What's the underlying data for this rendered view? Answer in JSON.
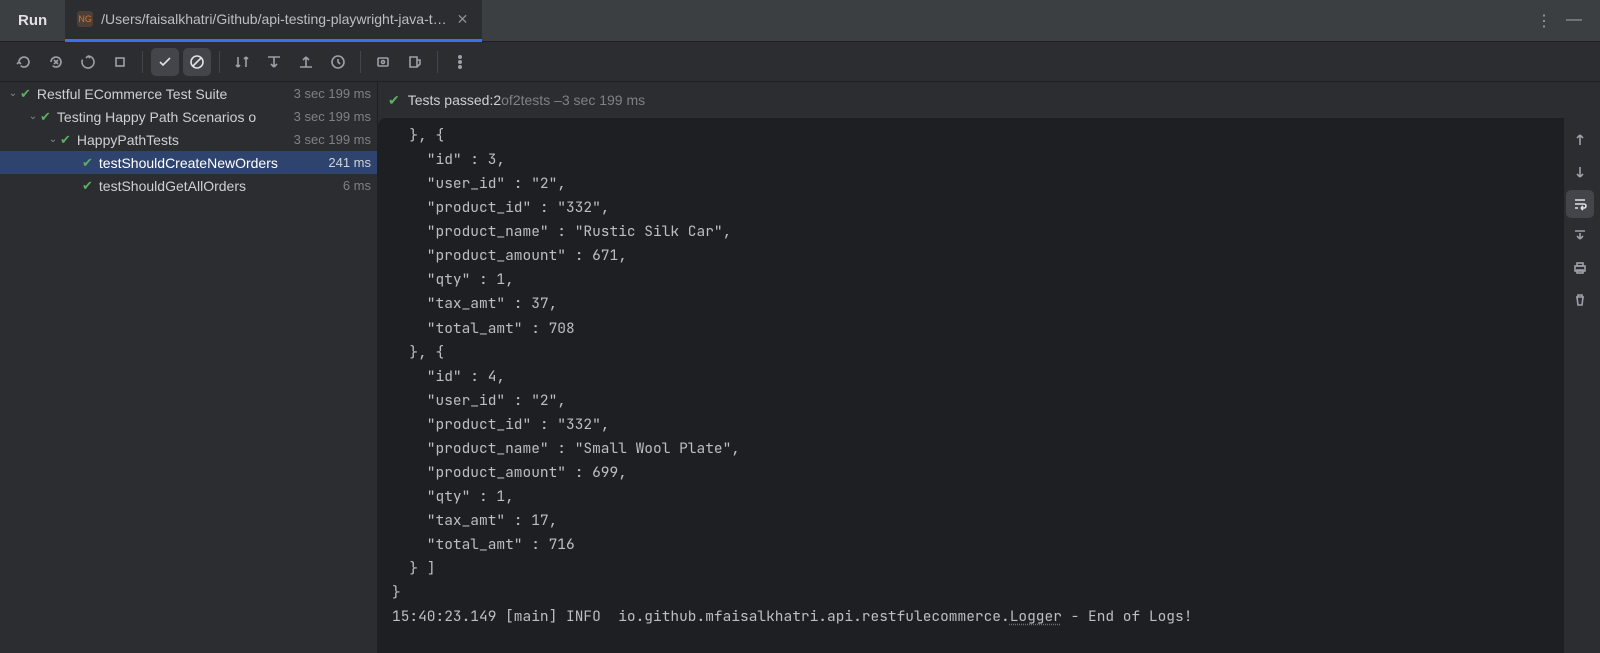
{
  "titlebar": {
    "run_label": "Run",
    "tab_path": "/Users/faisalkhatri/Github/api-testing-playwright-java-t…"
  },
  "status": {
    "prefix": "Tests passed: ",
    "passed": "2",
    "suffix1": " of ",
    "total": "2",
    "suffix2": " tests – ",
    "time": "3 sec 199 ms"
  },
  "tree": {
    "suite": {
      "name": "Restful ECommerce Test Suite",
      "dur": "3 sec 199 ms"
    },
    "group": {
      "name": "Testing Happy Path Scenarios o",
      "dur": "3 sec 199 ms"
    },
    "class": {
      "name": "HappyPathTests",
      "dur": "3 sec 199 ms"
    },
    "test1": {
      "name": "testShouldCreateNewOrders",
      "dur": "241 ms"
    },
    "test2": {
      "name": "testShouldGetAllOrders",
      "dur": "6 ms"
    }
  },
  "console_lines": [
    "  }, {",
    "    \"id\" : 3,",
    "    \"user_id\" : \"2\",",
    "    \"product_id\" : \"332\",",
    "    \"product_name\" : \"Rustic Silk Car\",",
    "    \"product_amount\" : 671,",
    "    \"qty\" : 1,",
    "    \"tax_amt\" : 37,",
    "    \"total_amt\" : 708",
    "  }, {",
    "    \"id\" : 4,",
    "    \"user_id\" : \"2\",",
    "    \"product_id\" : \"332\",",
    "    \"product_name\" : \"Small Wool Plate\",",
    "    \"product_amount\" : 699,",
    "    \"qty\" : 1,",
    "    \"tax_amt\" : 17,",
    "    \"total_amt\" : 716",
    "  } ]",
    "}"
  ],
  "log_line": {
    "time": "15:40:23.149 [main] INFO  io.github.mfaisalkhatri.api.restfulecommerce.",
    "logger": "Logger",
    "tail": " - End of Logs!"
  }
}
